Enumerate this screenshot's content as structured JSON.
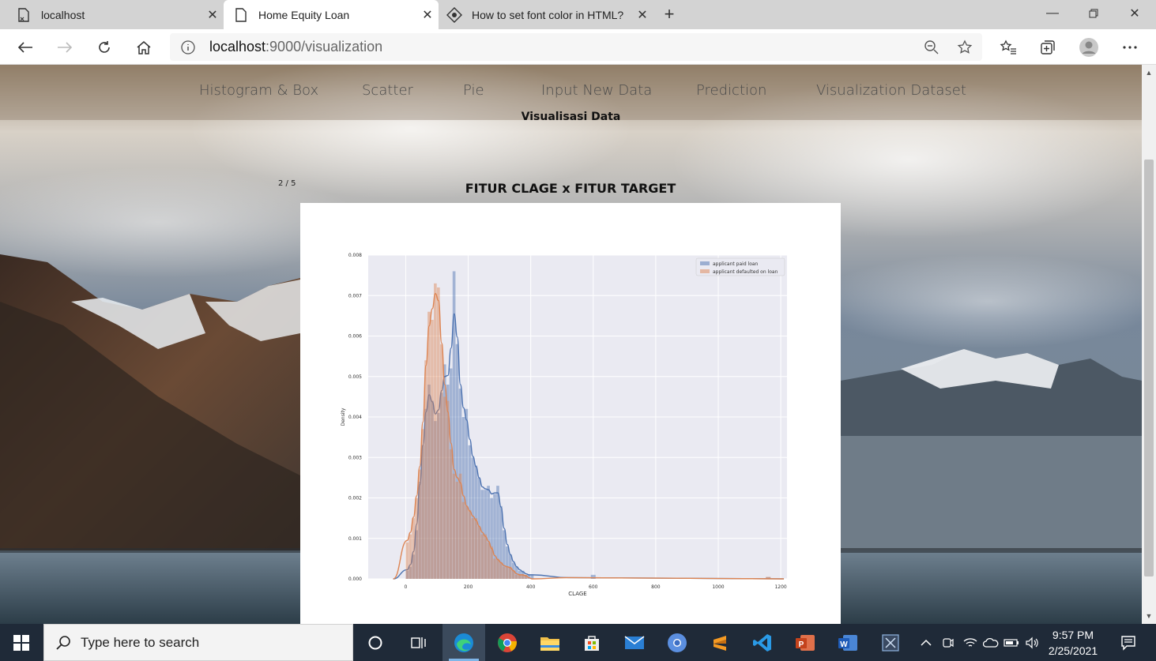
{
  "browser": {
    "tabs": [
      {
        "title": "localhost",
        "active": false
      },
      {
        "title": "Home Equity Loan",
        "active": true
      },
      {
        "title": "How to set font color in HTML?",
        "active": false
      }
    ],
    "url_host": "localhost",
    "url_rest": ":9000/visualization"
  },
  "site": {
    "nav": [
      "Histogram & Box",
      "Scatter",
      "Pie",
      "Input New Data",
      "Prediction",
      "Visualization Dataset"
    ],
    "subtitle": "Visualisasi Data",
    "slide_counter": "2 / 5",
    "chart_heading": "FITUR CLAGE x FITUR TARGET"
  },
  "chart_data": {
    "type": "bar",
    "xlabel": "CLAGE",
    "ylabel": "Density",
    "xlim": [
      -120,
      1220
    ],
    "ylim": [
      0,
      0.008
    ],
    "xticks": [
      "0",
      "200",
      "400",
      "600",
      "800",
      "1000",
      "1200"
    ],
    "xtick_values": [
      0,
      200,
      400,
      600,
      800,
      1000,
      1200
    ],
    "yticks": [
      "0.000",
      "0.001",
      "0.002",
      "0.003",
      "0.004",
      "0.005",
      "0.006",
      "0.007",
      "0.008"
    ],
    "ytick_values": [
      0,
      0.001,
      0.002,
      0.003,
      0.004,
      0.005,
      0.006,
      0.007,
      0.008
    ],
    "grid": true,
    "legend_position": "top-right",
    "bin_width": 10,
    "bin_starts": [
      0,
      10,
      20,
      30,
      40,
      50,
      60,
      70,
      80,
      90,
      100,
      110,
      120,
      130,
      140,
      150,
      160,
      170,
      180,
      190,
      200,
      210,
      220,
      230,
      240,
      250,
      260,
      270,
      280,
      290,
      300,
      310,
      320,
      330,
      340,
      350,
      360,
      370,
      380,
      390,
      400
    ],
    "series": [
      {
        "name": "applicant paid loan",
        "color": "#4c72b0",
        "values": [
          0.0002,
          0.0003,
          0.0006,
          0.0012,
          0.0024,
          0.0033,
          0.0042,
          0.0048,
          0.0044,
          0.0039,
          0.0041,
          0.0046,
          0.0053,
          0.0048,
          0.0052,
          0.0076,
          0.0058,
          0.0047,
          0.004,
          0.0042,
          0.0033,
          0.003,
          0.0028,
          0.0025,
          0.0022,
          0.0022,
          0.0023,
          0.002,
          0.0021,
          0.0023,
          0.0018,
          0.0012,
          0.0008,
          0.0006,
          0.0004,
          0.0003,
          0.0002,
          0.0002,
          0.0001,
          0.0001,
          0.0001
        ],
        "outliers": [
          {
            "x": 600,
            "y": 0.0001
          },
          {
            "x": 1160,
            "y": 4e-05
          }
        ]
      },
      {
        "name": "applicant defaulted on loan",
        "color": "#dd8452",
        "values": [
          0.0009,
          0.0011,
          0.0015,
          0.002,
          0.0027,
          0.0037,
          0.0054,
          0.0066,
          0.0064,
          0.0073,
          0.0072,
          0.0058,
          0.0045,
          0.0044,
          0.0032,
          0.0026,
          0.0024,
          0.0026,
          0.0019,
          0.0018,
          0.0017,
          0.0015,
          0.0015,
          0.0013,
          0.0011,
          0.0011,
          0.0009,
          0.0008,
          0.0005,
          0.0005,
          0.0004,
          0.0003,
          0.0003,
          0.0003,
          0.0002,
          0.0001,
          0.0001,
          0.0001,
          0.0001,
          0.0,
          0.0
        ],
        "outliers": [
          {
            "x": 1160,
            "y": 5e-05
          }
        ]
      }
    ]
  },
  "taskbar": {
    "search_placeholder": "Type here to search",
    "time": "9:57 PM",
    "date": "2/25/2021"
  },
  "colors": {
    "tabbar_bg": "#d3d3d3",
    "taskbar_bg": "#1f2a38",
    "plot_bg": "#eaeaf2"
  }
}
